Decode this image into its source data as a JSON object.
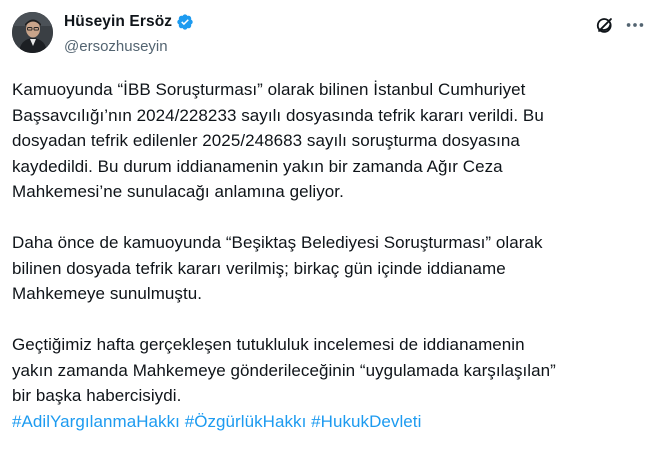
{
  "post": {
    "author": {
      "display_name": "Hüseyin Ersöz",
      "handle": "@ersozhuseyin",
      "verified": true,
      "verified_color": "#1d9bf0"
    },
    "icons": {
      "grok": "grok-icon",
      "more": "more-horizontal-icon"
    },
    "paragraphs": [
      "Kamuoyunda “İBB Soruşturması” olarak bilinen İstanbul Cumhuriyet\nBaşsavcılığı’nın 2024/228233 sayılı dosyasında tefrik kararı verildi. Bu\ndosyadan tefrik edilenler 2025/248683 sayılı soruşturma dosyasına\nkaydedildi. Bu durum iddianamenin yakın bir zamanda Ağır Ceza\nMahkemesi’ne sunulacağı anlamına geliyor.",
      "Daha önce de kamuoyunda “Beşiktaş Belediyesi Soruşturması” olarak\nbilinen dosyada tefrik kararı verilmiş; birkaç gün içinde iddianame\nMahkemeye sunulmuştu.",
      "Geçtiğimiz hafta gerçekleşen tutukluluk incelemesi de iddianamenin\nyakın zamanda Mahkemeye gönderileceğinin “uygulamada karşılaşılan”\nbir başka habercisiydi."
    ],
    "hashtags": [
      "#AdilYargılanmaHakkı",
      "#ÖzgürlükHakkı",
      "#HukukDevleti"
    ],
    "colors": {
      "text": "#0f1419",
      "secondary": "#536471",
      "link": "#1d9bf0"
    }
  }
}
